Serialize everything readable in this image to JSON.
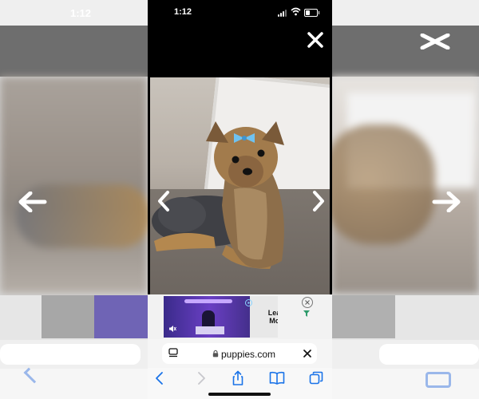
{
  "status_bar": {
    "time": "1:12",
    "icons": [
      "cellular-signal-icon",
      "wifi-icon",
      "battery-icon"
    ],
    "text_color": "#ffffff",
    "background": "#000000"
  },
  "viewer": {
    "close_icon": "close-icon",
    "prev_icon": "chevron-left-icon",
    "next_icon": "chevron-right-icon",
    "photo_subject": "yorkshire-terrier-photo"
  },
  "ad": {
    "cta_line1": "Learn",
    "cta_line2": "More",
    "close_icon": "ad-close-icon",
    "choices_icon": "ad-choices-icon"
  },
  "url_bar": {
    "domain": "puppies.com",
    "reader_icon": "page-menu-icon",
    "lock_icon": "lock-icon",
    "clear_icon": "close-icon"
  },
  "toolbar": {
    "buttons": [
      "back-icon",
      "forward-icon",
      "share-icon",
      "bookmarks-icon",
      "tabs-icon"
    ],
    "accent_color": "#1a73e8"
  },
  "ghost": {
    "time": "1:12"
  }
}
